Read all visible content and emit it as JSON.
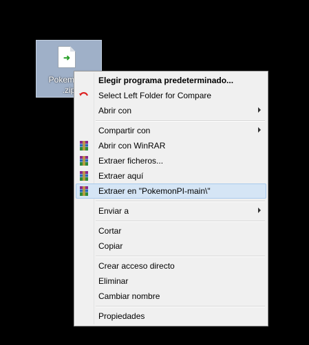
{
  "desktop_icon": {
    "label_line1": "PokemonP",
    "label_line2": ".zip"
  },
  "menu": {
    "items": [
      {
        "label": "Elegir programa predeterminado...",
        "bold": true,
        "icon": "none",
        "submenu": false
      },
      {
        "label": "Select Left Folder for Compare",
        "icon": "compare-undo-icon",
        "submenu": false
      },
      {
        "label": "Abrir con",
        "icon": "none",
        "submenu": true
      },
      {
        "label": "Compartir con",
        "icon": "none",
        "submenu": true
      },
      {
        "label": "Abrir con WinRAR",
        "icon": "winrar-icon",
        "submenu": false
      },
      {
        "label": "Extraer ficheros...",
        "icon": "winrar-icon",
        "submenu": false
      },
      {
        "label": "Extraer aquí",
        "icon": "winrar-icon",
        "submenu": false
      },
      {
        "label": "Extraer en \"PokemonPI-main\\\"",
        "icon": "winrar-icon",
        "submenu": false,
        "highlighted": true
      },
      {
        "label": "Enviar a",
        "icon": "none",
        "submenu": true
      },
      {
        "label": "Cortar",
        "icon": "none",
        "submenu": false
      },
      {
        "label": "Copiar",
        "icon": "none",
        "submenu": false
      },
      {
        "label": "Crear acceso directo",
        "icon": "none",
        "submenu": false
      },
      {
        "label": "Eliminar",
        "icon": "none",
        "submenu": false
      },
      {
        "label": "Cambiar nombre",
        "icon": "none",
        "submenu": false
      },
      {
        "label": "Propiedades",
        "icon": "none",
        "submenu": false
      }
    ]
  },
  "colors": {
    "highlight_bg": "#d5e5f5",
    "highlight_border": "#a8c9ec",
    "menu_bg": "#f0f0f0",
    "desktop_bg": "#000000"
  }
}
